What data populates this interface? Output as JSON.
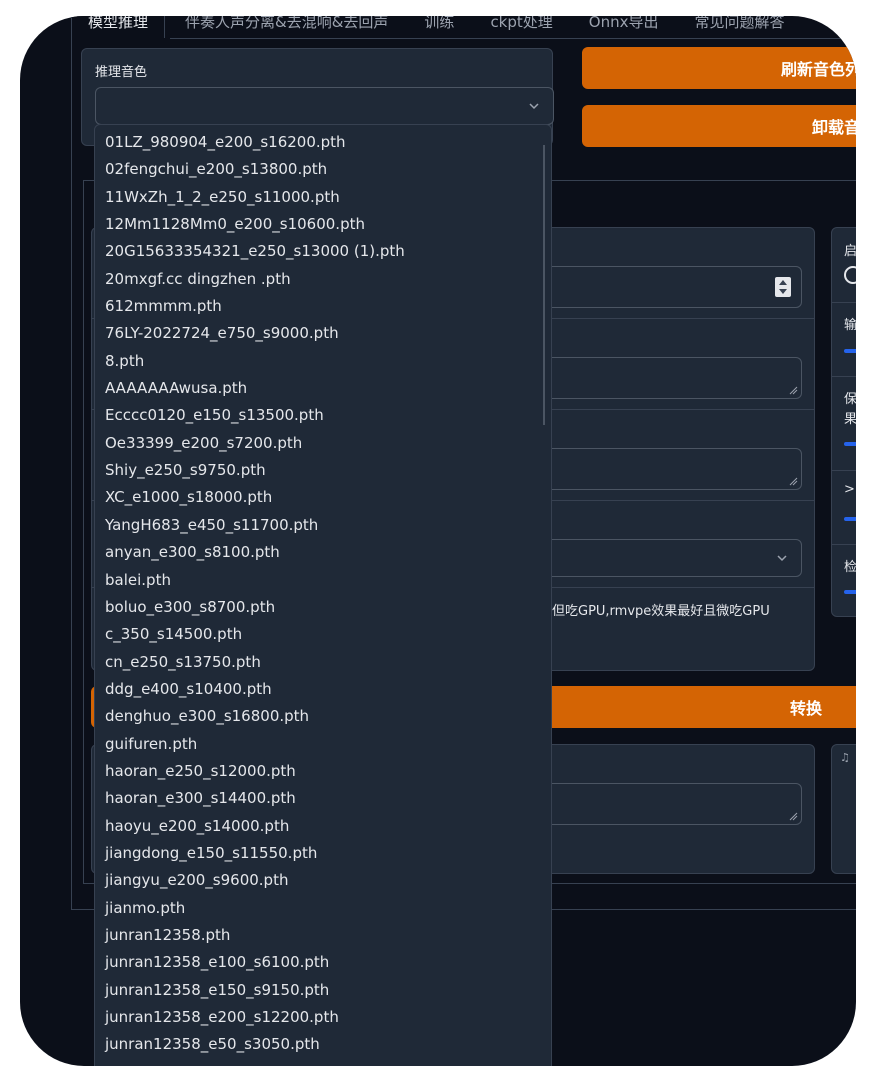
{
  "tabs": [
    "模型推理",
    "伴奏人声分离&去混响&去回声",
    "训练",
    "ckpt处理",
    "Onnx导出",
    "常见问题解答"
  ],
  "voice_label": "推理音色",
  "buttons": {
    "refresh": "刷新音色列表和",
    "unload": "卸载音色省",
    "convert": "转换"
  },
  "hint_text": "果好但吃GPU,rmvpe效果最好且微吃GPU",
  "right_labels": [
    "启",
    "输",
    "保",
    "果",
    ">=",
    "检"
  ],
  "dropdown_items": [
    "01LZ_980904_e200_s16200.pth",
    "02fengchui_e200_s13800.pth",
    "11WxZh_1_2_e250_s11000.pth",
    "12Mm1128Mm0_e200_s10600.pth",
    "20G15633354321_e250_s13000 (1).pth",
    "20mxgf.cc dingzhen .pth",
    "612mmmm.pth",
    "76LY-2022724_e750_s9000.pth",
    "8.pth",
    "AAAAAAAwusa.pth",
    "Ecccc0120_e150_s13500.pth",
    "Oe33399_e200_s7200.pth",
    "Shiy_e250_s9750.pth",
    "XC_e1000_s18000.pth",
    "YangH683_e450_s11700.pth",
    "anyan_e300_s8100.pth",
    "balei.pth",
    "boluo_e300_s8700.pth",
    "c_350_s14500.pth",
    "cn_e250_s13750.pth",
    "ddg_e400_s10400.pth",
    "denghuo_e300_s16800.pth",
    "guifuren.pth",
    "haoran_e250_s12000.pth",
    "haoran_e300_s14400.pth",
    "haoyu_e200_s14000.pth",
    "jiangdong_e150_s11550.pth",
    "jiangyu_e200_s9600.pth",
    "jianmo.pth",
    "junran12358.pth",
    "junran12358_e100_s6100.pth",
    "junran12358_e150_s9150.pth",
    "junran12358_e200_s12200.pth",
    "junran12358_e50_s3050.pth"
  ]
}
